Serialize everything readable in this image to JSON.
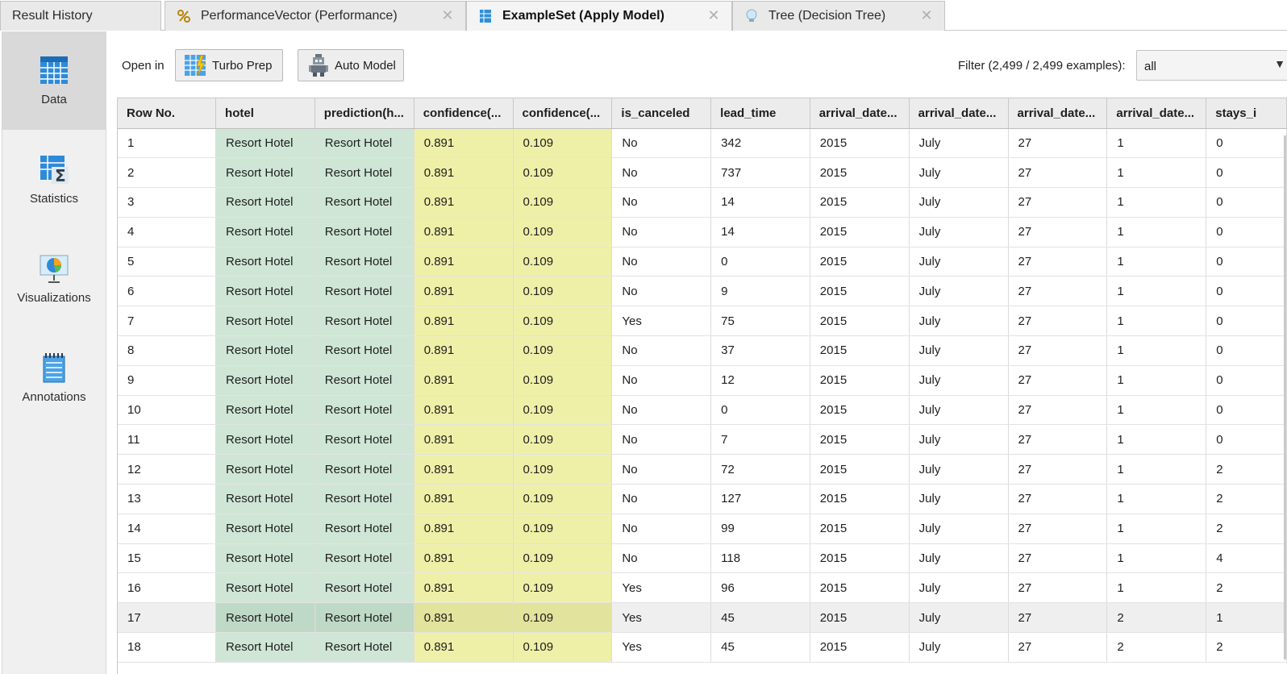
{
  "tabs": {
    "result_history": "Result History",
    "performance": "PerformanceVector (Performance)",
    "exampleset": "ExampleSet (Apply Model)",
    "tree": "Tree (Decision Tree)"
  },
  "sidebar": {
    "data": "Data",
    "statistics": "Statistics",
    "visualizations": "Visualizations",
    "annotations": "Annotations"
  },
  "toolbar": {
    "open_in": "Open in",
    "turbo_prep": "Turbo Prep",
    "auto_model": "Auto Model",
    "filter_label": "Filter (2,499 / 2,499 examples):",
    "filter_value": "all"
  },
  "colors": {
    "label_column": "#cfe6d6",
    "confidence_column": "#eff0a8",
    "selected_row": "#efefef"
  },
  "table": {
    "columns": [
      "Row No.",
      "hotel",
      "prediction(h...",
      "confidence(...",
      "confidence(...",
      "is_canceled",
      "lead_time",
      "arrival_date...",
      "arrival_date...",
      "arrival_date...",
      "arrival_date...",
      "stays_i"
    ],
    "rows": [
      [
        "1",
        "Resort Hotel",
        "Resort Hotel",
        "0.891",
        "0.109",
        "No",
        "342",
        "2015",
        "July",
        "27",
        "1",
        "0"
      ],
      [
        "2",
        "Resort Hotel",
        "Resort Hotel",
        "0.891",
        "0.109",
        "No",
        "737",
        "2015",
        "July",
        "27",
        "1",
        "0"
      ],
      [
        "3",
        "Resort Hotel",
        "Resort Hotel",
        "0.891",
        "0.109",
        "No",
        "14",
        "2015",
        "July",
        "27",
        "1",
        "0"
      ],
      [
        "4",
        "Resort Hotel",
        "Resort Hotel",
        "0.891",
        "0.109",
        "No",
        "14",
        "2015",
        "July",
        "27",
        "1",
        "0"
      ],
      [
        "5",
        "Resort Hotel",
        "Resort Hotel",
        "0.891",
        "0.109",
        "No",
        "0",
        "2015",
        "July",
        "27",
        "1",
        "0"
      ],
      [
        "6",
        "Resort Hotel",
        "Resort Hotel",
        "0.891",
        "0.109",
        "No",
        "9",
        "2015",
        "July",
        "27",
        "1",
        "0"
      ],
      [
        "7",
        "Resort Hotel",
        "Resort Hotel",
        "0.891",
        "0.109",
        "Yes",
        "75",
        "2015",
        "July",
        "27",
        "1",
        "0"
      ],
      [
        "8",
        "Resort Hotel",
        "Resort Hotel",
        "0.891",
        "0.109",
        "No",
        "37",
        "2015",
        "July",
        "27",
        "1",
        "0"
      ],
      [
        "9",
        "Resort Hotel",
        "Resort Hotel",
        "0.891",
        "0.109",
        "No",
        "12",
        "2015",
        "July",
        "27",
        "1",
        "0"
      ],
      [
        "10",
        "Resort Hotel",
        "Resort Hotel",
        "0.891",
        "0.109",
        "No",
        "0",
        "2015",
        "July",
        "27",
        "1",
        "0"
      ],
      [
        "11",
        "Resort Hotel",
        "Resort Hotel",
        "0.891",
        "0.109",
        "No",
        "7",
        "2015",
        "July",
        "27",
        "1",
        "0"
      ],
      [
        "12",
        "Resort Hotel",
        "Resort Hotel",
        "0.891",
        "0.109",
        "No",
        "72",
        "2015",
        "July",
        "27",
        "1",
        "2"
      ],
      [
        "13",
        "Resort Hotel",
        "Resort Hotel",
        "0.891",
        "0.109",
        "No",
        "127",
        "2015",
        "July",
        "27",
        "1",
        "2"
      ],
      [
        "14",
        "Resort Hotel",
        "Resort Hotel",
        "0.891",
        "0.109",
        "No",
        "99",
        "2015",
        "July",
        "27",
        "1",
        "2"
      ],
      [
        "15",
        "Resort Hotel",
        "Resort Hotel",
        "0.891",
        "0.109",
        "No",
        "118",
        "2015",
        "July",
        "27",
        "1",
        "4"
      ],
      [
        "16",
        "Resort Hotel",
        "Resort Hotel",
        "0.891",
        "0.109",
        "Yes",
        "96",
        "2015",
        "July",
        "27",
        "1",
        "2"
      ],
      [
        "17",
        "Resort Hotel",
        "Resort Hotel",
        "0.891",
        "0.109",
        "Yes",
        "45",
        "2015",
        "July",
        "27",
        "2",
        "1"
      ],
      [
        "18",
        "Resort Hotel",
        "Resort Hotel",
        "0.891",
        "0.109",
        "Yes",
        "45",
        "2015",
        "July",
        "27",
        "2",
        "2"
      ]
    ],
    "selected_row": 17
  }
}
